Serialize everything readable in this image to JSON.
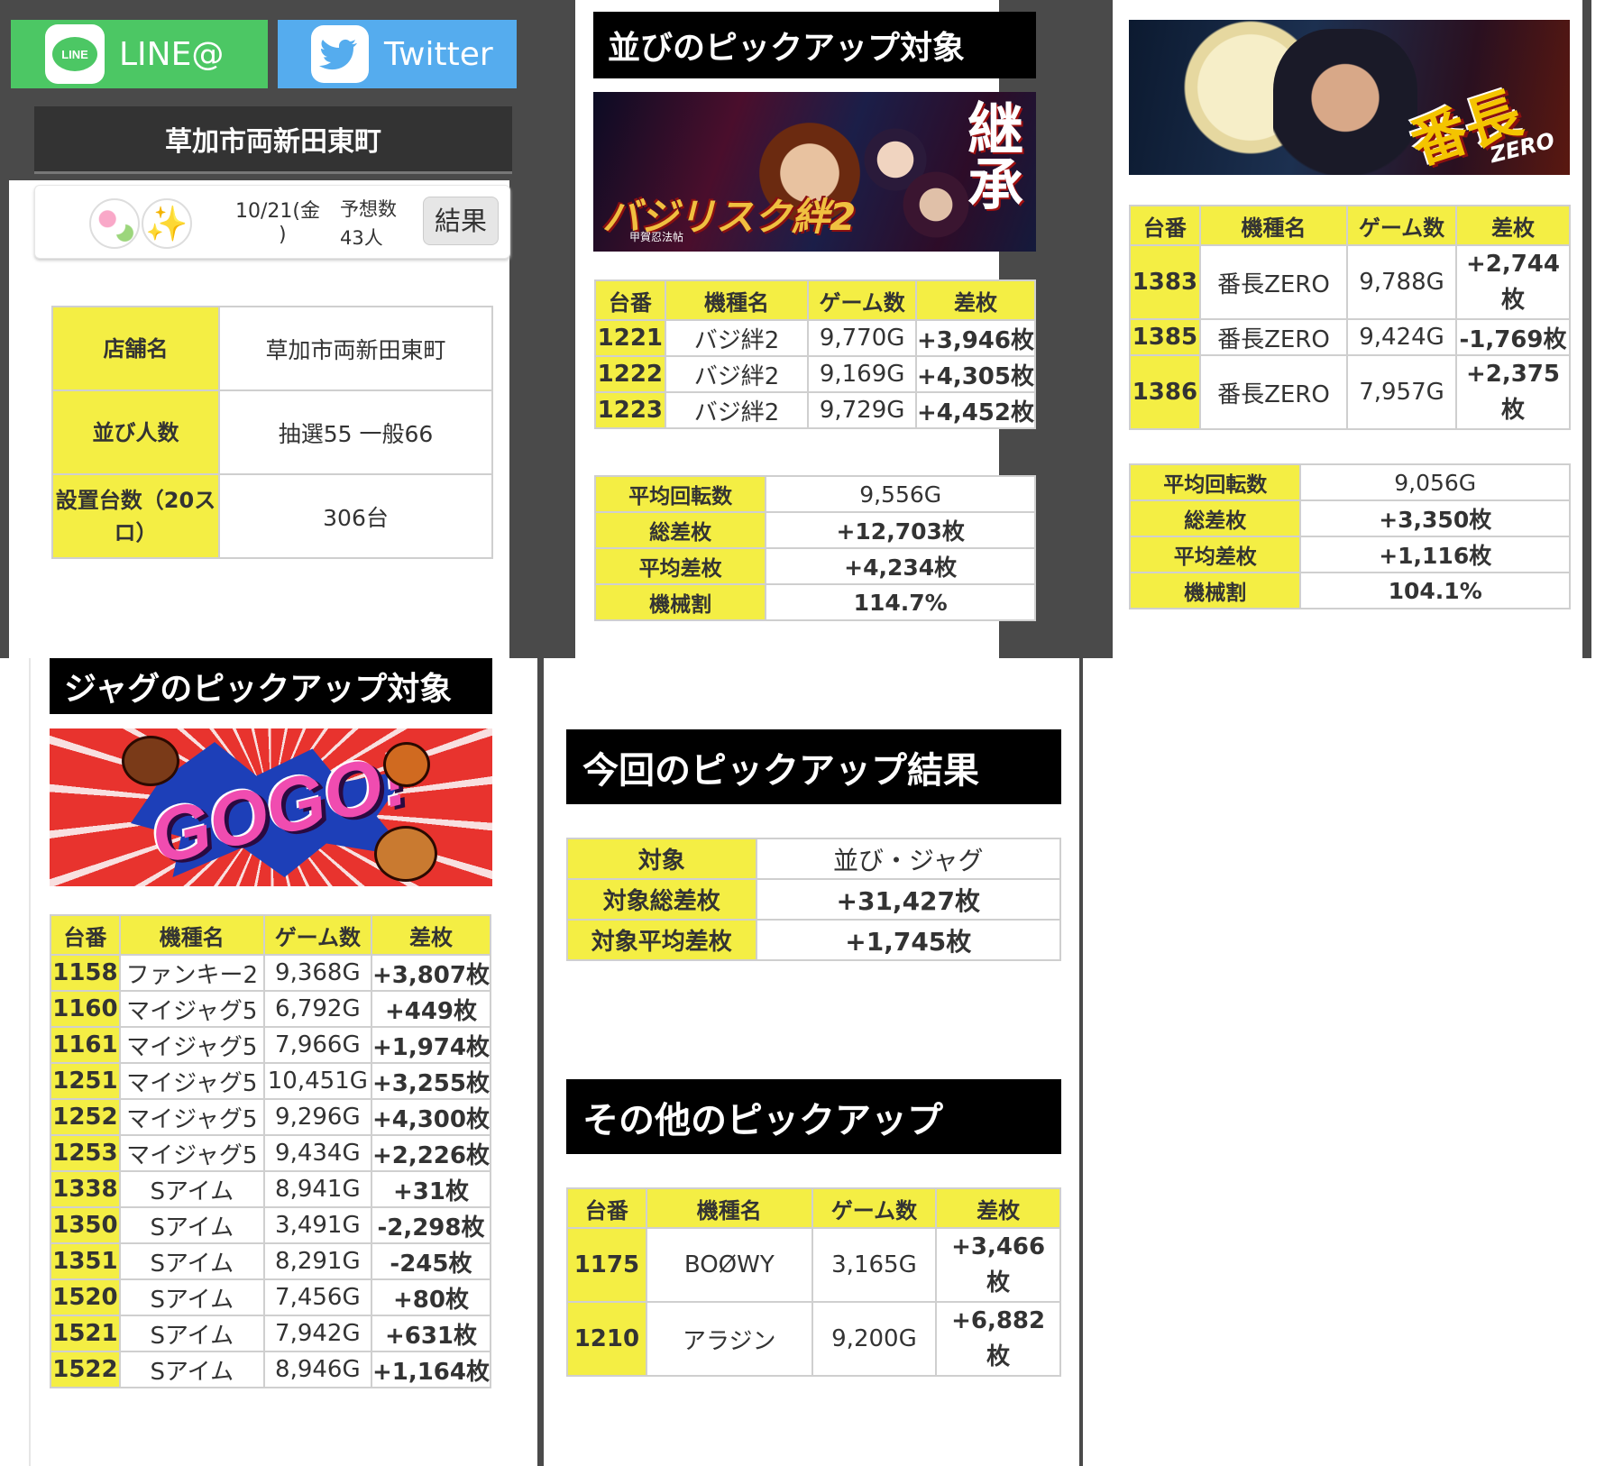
{
  "header": {
    "line_label": "LINE@",
    "line_icon_text": "LINE",
    "twitter_label": "Twitter",
    "store_title": "草加市両新田東町"
  },
  "card": {
    "date": "10/21(金",
    "date_close": ")",
    "yoso_label": "予想数",
    "yoso_count": "43人",
    "result_button": "結果"
  },
  "store_info": [
    {
      "label": "店舗名",
      "value": "草加市両新田東町"
    },
    {
      "label": "並び人数",
      "value": "抽選55 一般66"
    },
    {
      "label": "設置台数（20スロ）",
      "value": "306台"
    }
  ],
  "narabi": {
    "title": "並びのピックアップ対象",
    "banner_text": "バジリスク絆2",
    "banner_sub": "甲賀忍法帖",
    "banner_kanji": "継承",
    "headers": [
      "台番",
      "機種名",
      "ゲーム数",
      "差枚"
    ],
    "rows": [
      {
        "num": "1221",
        "name": "バジ絆2",
        "games": "9,770G",
        "diff": "+3,946枚"
      },
      {
        "num": "1222",
        "name": "バジ絆2",
        "games": "9,169G",
        "diff": "+4,305枚"
      },
      {
        "num": "1223",
        "name": "バジ絆2",
        "games": "9,729G",
        "diff": "+4,452枚"
      }
    ],
    "summary": [
      {
        "label": "平均回転数",
        "value": "9,556G"
      },
      {
        "label": "総差枚",
        "value": "+12,703枚"
      },
      {
        "label": "平均差枚",
        "value": "+4,234枚"
      },
      {
        "label": "機械割",
        "value": "114.7%"
      }
    ]
  },
  "bancho": {
    "banner_text": "番長",
    "banner_sub": "ZERO",
    "headers": [
      "台番",
      "機種名",
      "ゲーム数",
      "差枚"
    ],
    "rows": [
      {
        "num": "1383",
        "name": "番長ZERO",
        "games": "9,788G",
        "diff": "+2,744枚"
      },
      {
        "num": "1385",
        "name": "番長ZERO",
        "games": "9,424G",
        "diff": "-1,769枚"
      },
      {
        "num": "1386",
        "name": "番長ZERO",
        "games": "7,957G",
        "diff": "+2,375枚"
      }
    ],
    "summary": [
      {
        "label": "平均回転数",
        "value": "9,056G"
      },
      {
        "label": "総差枚",
        "value": "+3,350枚"
      },
      {
        "label": "平均差枚",
        "value": "+1,116枚"
      },
      {
        "label": "機械割",
        "value": "104.1%"
      }
    ]
  },
  "jag": {
    "title": "ジャグのピックアップ対象",
    "banner_text": "GOGO!",
    "headers": [
      "台番",
      "機種名",
      "ゲーム数",
      "差枚"
    ],
    "rows": [
      {
        "num": "1158",
        "name": "ファンキー2",
        "games": "9,368G",
        "diff": "+3,807枚"
      },
      {
        "num": "1160",
        "name": "マイジャグ5",
        "games": "6,792G",
        "diff": "+449枚"
      },
      {
        "num": "1161",
        "name": "マイジャグ5",
        "games": "7,966G",
        "diff": "+1,974枚"
      },
      {
        "num": "1251",
        "name": "マイジャグ5",
        "games": "10,451G",
        "diff": "+3,255枚"
      },
      {
        "num": "1252",
        "name": "マイジャグ5",
        "games": "9,296G",
        "diff": "+4,300枚"
      },
      {
        "num": "1253",
        "name": "マイジャグ5",
        "games": "9,434G",
        "diff": "+2,226枚"
      },
      {
        "num": "1338",
        "name": "Sアイム",
        "games": "8,941G",
        "diff": "+31枚"
      },
      {
        "num": "1350",
        "name": "Sアイム",
        "games": "3,491G",
        "diff": "-2,298枚"
      },
      {
        "num": "1351",
        "name": "Sアイム",
        "games": "8,291G",
        "diff": "-245枚"
      },
      {
        "num": "1520",
        "name": "Sアイム",
        "games": "7,456G",
        "diff": "+80枚"
      },
      {
        "num": "1521",
        "name": "Sアイム",
        "games": "7,942G",
        "diff": "+631枚"
      },
      {
        "num": "1522",
        "name": "Sアイム",
        "games": "8,946G",
        "diff": "+1,164枚"
      }
    ]
  },
  "result": {
    "title": "今回のピックアップ結果",
    "rows": [
      {
        "label": "対象",
        "value": "並び・ジャグ"
      },
      {
        "label": "対象総差枚",
        "value": "+31,427枚"
      },
      {
        "label": "対象平均差枚",
        "value": "+1,745枚"
      }
    ]
  },
  "other": {
    "title": "その他のピックアップ",
    "headers": [
      "台番",
      "機種名",
      "ゲーム数",
      "差枚"
    ],
    "rows": [
      {
        "num": "1175",
        "name": "BOØWY",
        "games": "3,165G",
        "diff": "+3,466枚"
      },
      {
        "num": "1210",
        "name": "アラジン",
        "games": "9,200G",
        "diff": "+6,882枚"
      }
    ]
  },
  "colors": {
    "yellow": "#f4ee44",
    "positive": "#2323c8",
    "negative": "#d8242c",
    "line_green": "#4cc764",
    "twitter_blue": "#55acee"
  }
}
